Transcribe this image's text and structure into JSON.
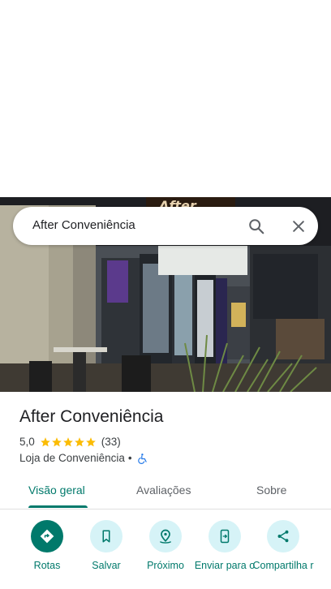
{
  "search": {
    "query": "After Conveniência"
  },
  "place": {
    "name": "After Conveniência",
    "rating": "5,0",
    "stars": 5,
    "review_count": "(33)",
    "category": "Loja de Conveniência",
    "separator": "•",
    "accessibility_icon": "wheelchair-icon"
  },
  "tabs": [
    {
      "label": "Visão geral",
      "active": true
    },
    {
      "label": "Avaliações",
      "active": false
    },
    {
      "label": "Sobre",
      "active": false
    }
  ],
  "actions": [
    {
      "label": "Rotas",
      "icon": "directions-icon"
    },
    {
      "label": "Salvar",
      "icon": "bookmark-icon"
    },
    {
      "label": "Próximo",
      "icon": "nearby-icon"
    },
    {
      "label": "Enviar para o",
      "icon": "send-to-phone-icon"
    },
    {
      "label": "Compartilha r",
      "icon": "share-icon"
    }
  ],
  "colors": {
    "accent": "#00796b",
    "action_bg": "#d6f3f7",
    "star": "#fbbc04",
    "accessibility": "#1a73e8"
  }
}
